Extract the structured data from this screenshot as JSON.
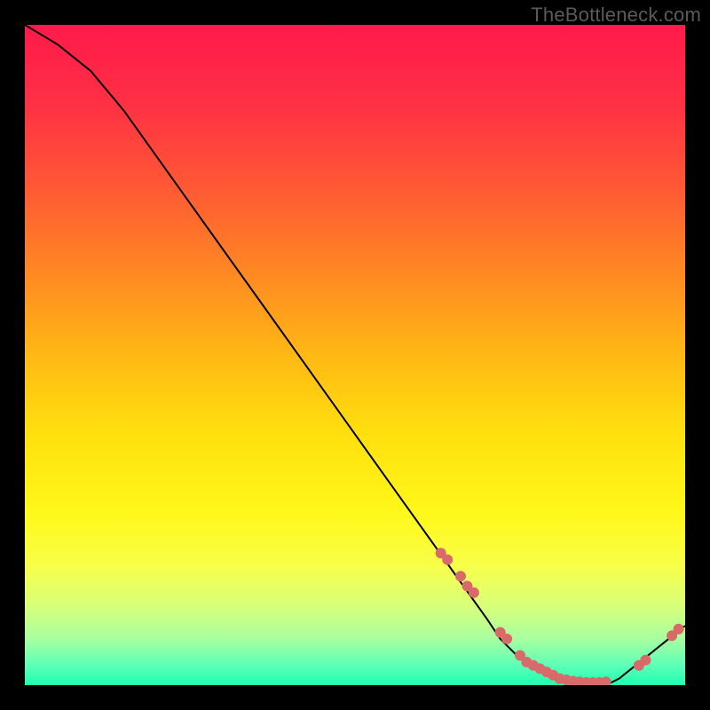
{
  "watermark": "TheBottleneck.com",
  "chart_data": {
    "type": "line",
    "title": "",
    "xlabel": "",
    "ylabel": "",
    "xlim": [
      0,
      100
    ],
    "ylim": [
      0,
      100
    ],
    "curve": {
      "name": "bottleneck-curve",
      "x": [
        0,
        5,
        10,
        15,
        20,
        25,
        30,
        35,
        40,
        45,
        50,
        55,
        60,
        65,
        70,
        72,
        75,
        80,
        85,
        88,
        90,
        95,
        100
      ],
      "y": [
        100,
        97,
        93,
        87,
        80,
        73,
        66,
        59,
        52,
        45,
        38,
        31,
        24,
        17,
        10,
        7,
        4,
        1,
        0,
        0,
        1,
        5,
        9
      ]
    },
    "points": {
      "name": "sample-points",
      "color": "#d86a6a",
      "x": [
        63,
        64,
        66,
        67,
        68,
        72,
        73,
        75,
        76,
        77,
        78,
        79,
        80,
        81,
        82,
        83,
        84,
        85,
        86,
        87,
        88,
        93,
        94,
        98,
        99
      ],
      "y": [
        20,
        19,
        16.5,
        15,
        14,
        8,
        7,
        4.5,
        3.5,
        3,
        2.5,
        2,
        1.5,
        1,
        0.8,
        0.6,
        0.5,
        0.4,
        0.4,
        0.4,
        0.5,
        3,
        3.8,
        7.5,
        8.5
      ]
    },
    "background_gradient": {
      "stops": [
        {
          "offset": 0.0,
          "color": "#ff1a4b"
        },
        {
          "offset": 0.12,
          "color": "#ff3044"
        },
        {
          "offset": 0.25,
          "color": "#ff5a34"
        },
        {
          "offset": 0.38,
          "color": "#ff8a22"
        },
        {
          "offset": 0.5,
          "color": "#ffb814"
        },
        {
          "offset": 0.62,
          "color": "#ffe00e"
        },
        {
          "offset": 0.74,
          "color": "#fff81a"
        },
        {
          "offset": 0.82,
          "color": "#f7ff4a"
        },
        {
          "offset": 0.88,
          "color": "#d8ff7a"
        },
        {
          "offset": 0.93,
          "color": "#a8ffa0"
        },
        {
          "offset": 0.97,
          "color": "#5dffb8"
        },
        {
          "offset": 1.0,
          "color": "#1dffb0"
        }
      ]
    }
  }
}
